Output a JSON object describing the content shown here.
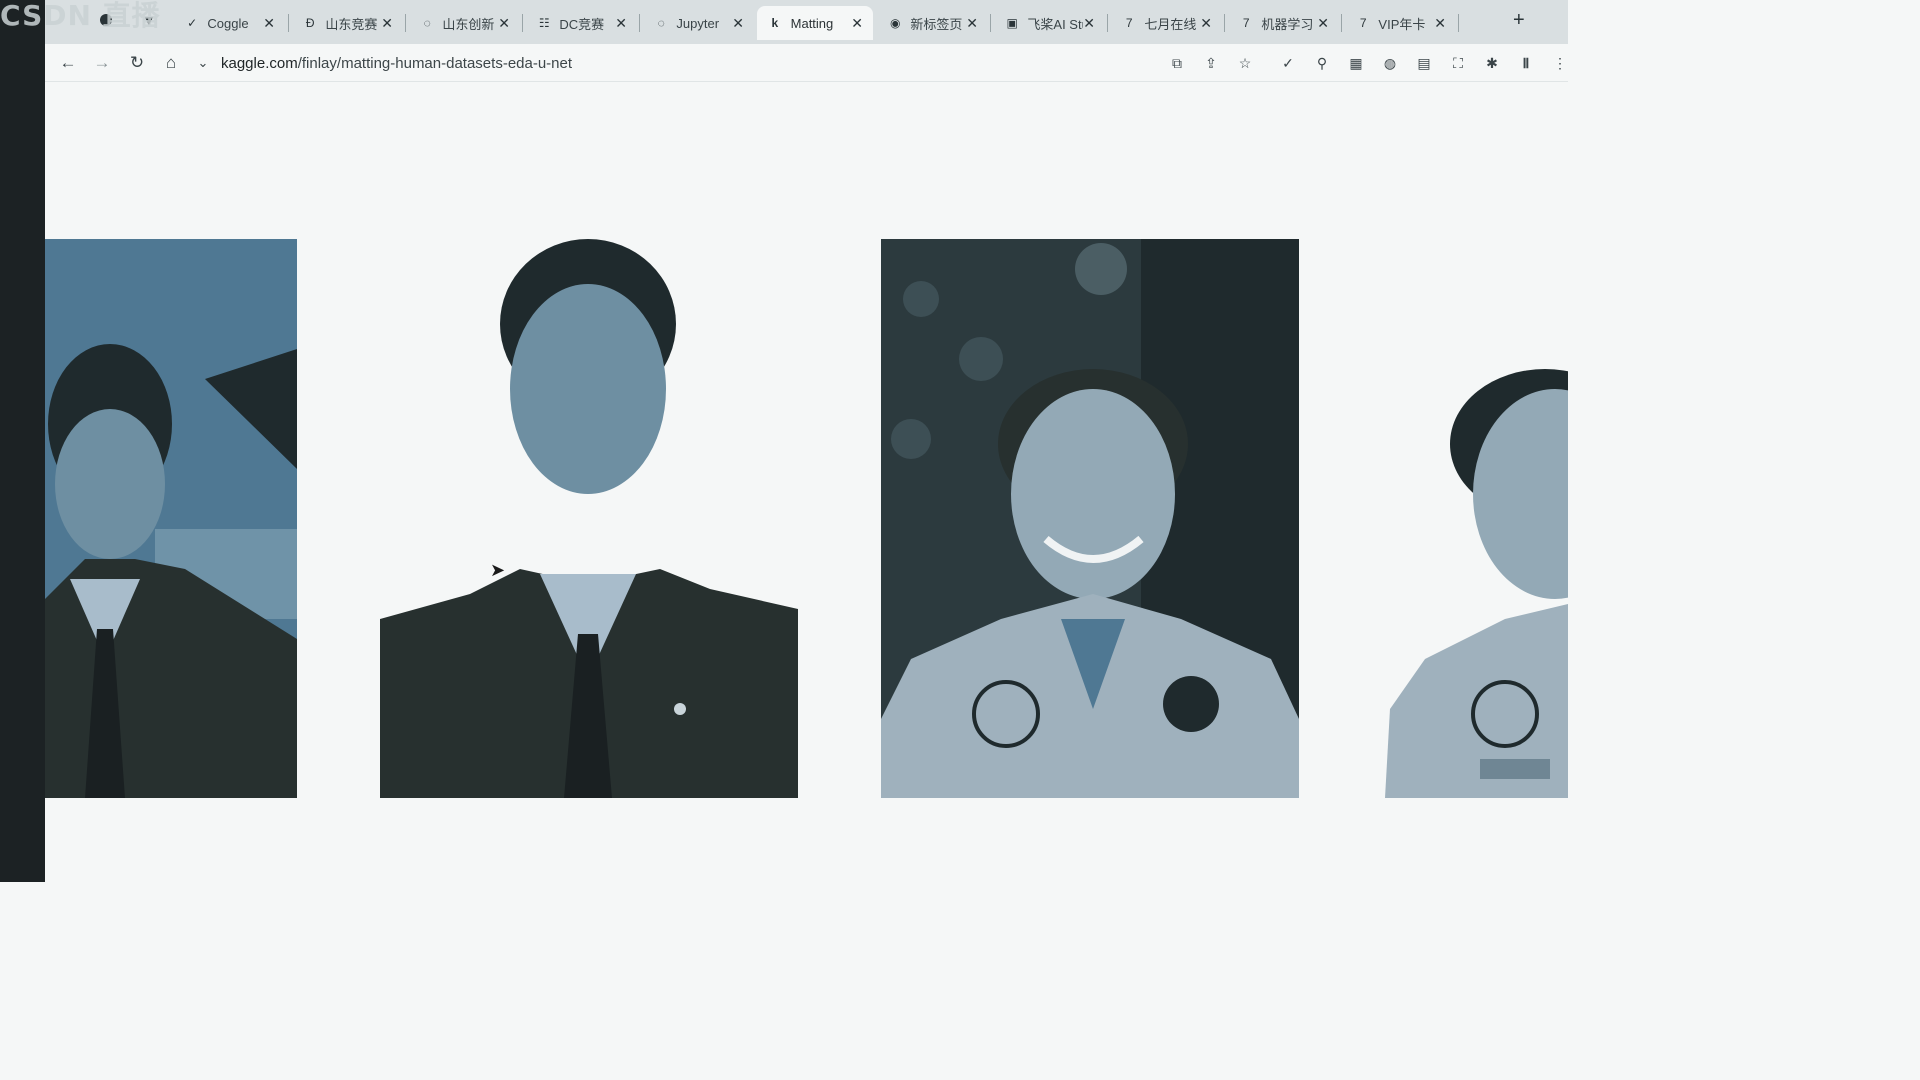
{
  "overlay": {
    "logo_text": "CSDN 直播"
  },
  "tabs": [
    {
      "label": "Coggle",
      "icon": "check-circle-icon"
    },
    {
      "label": "山东竞赛",
      "icon": "d-logo-icon"
    },
    {
      "label": "山东创新",
      "icon": "loading-icon"
    },
    {
      "label": "DC竞赛",
      "icon": "dc-logo-icon"
    },
    {
      "label": "Jupyter",
      "icon": "loading-icon"
    },
    {
      "label": "Matting",
      "icon": "kaggle-k-icon",
      "active": true
    },
    {
      "label": "新标签页",
      "icon": "chrome-icon"
    },
    {
      "label": "飞桨AI Studio",
      "icon": "paddle-icon"
    },
    {
      "label": "七月在线",
      "icon": "zhihu-icon"
    },
    {
      "label": "机器学习",
      "icon": "zhihu-icon"
    },
    {
      "label": "VIP年卡",
      "icon": "zhihu-icon"
    }
  ],
  "address_bar": {
    "domain": "kaggle.com",
    "path": "/finlay/matting-human-datasets-eda-u-net"
  },
  "colors": {
    "accent": "#4f7893",
    "background": "#f5f7f7",
    "dark_strip": "#1c2224"
  }
}
